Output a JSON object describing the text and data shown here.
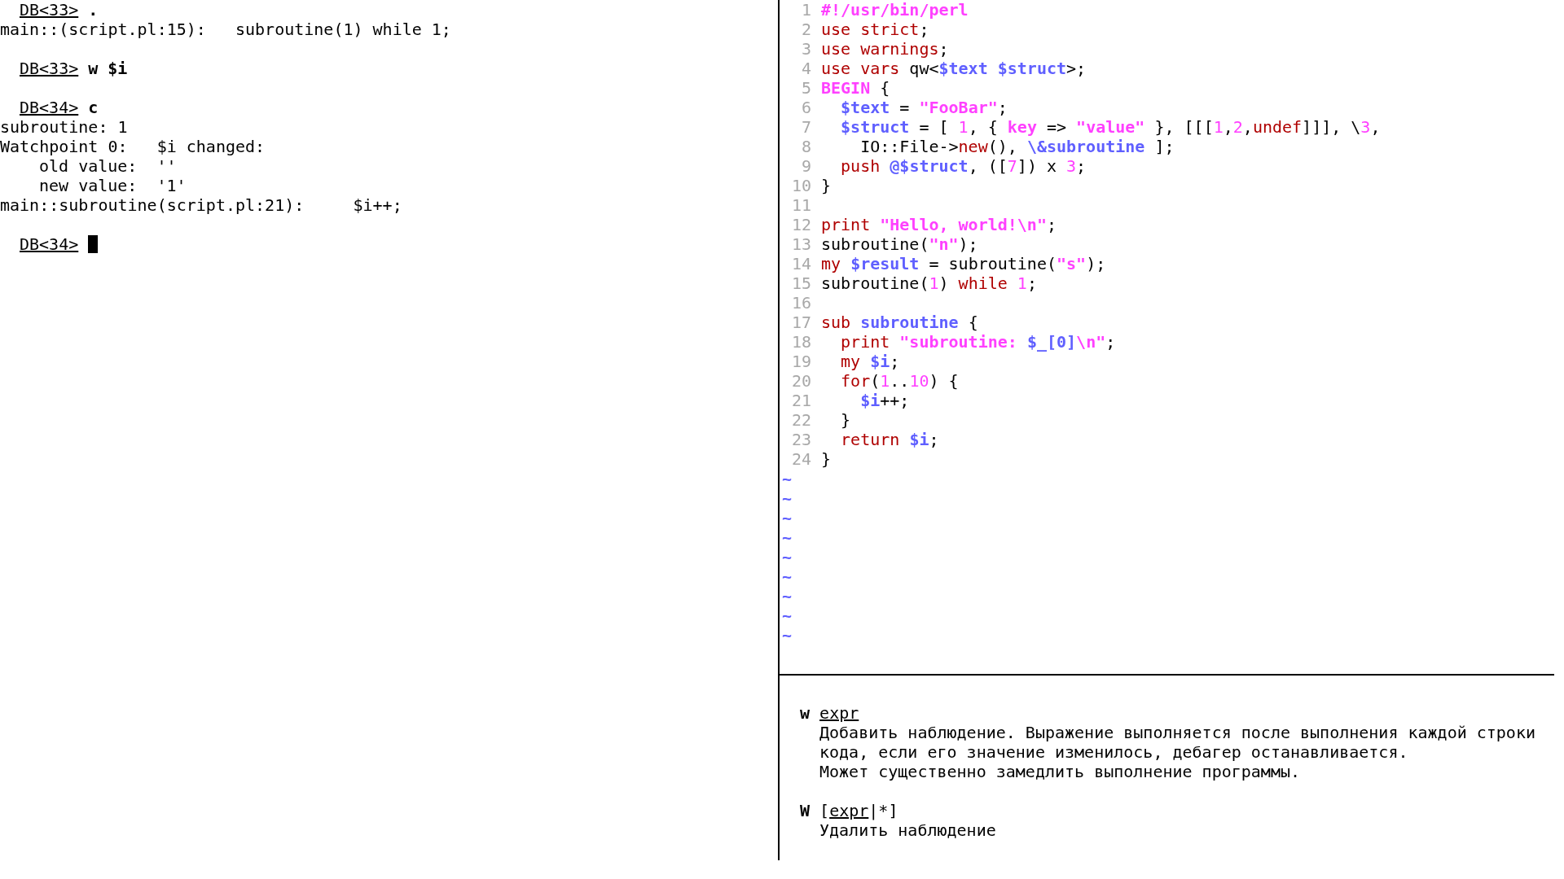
{
  "terminal": {
    "lines": [
      {
        "kind": "prompt",
        "prompt": "DB<33>",
        "command": ".",
        "cursor": false
      },
      {
        "kind": "output",
        "text": "main::(script.pl:15):   subroutine(1) while 1;"
      },
      {
        "kind": "blank"
      },
      {
        "kind": "prompt",
        "prompt": "DB<33>",
        "command": "w $i",
        "cursor": false
      },
      {
        "kind": "blank"
      },
      {
        "kind": "prompt",
        "prompt": "DB<34>",
        "command": "c",
        "cursor": false
      },
      {
        "kind": "output",
        "text": "subroutine: 1"
      },
      {
        "kind": "output",
        "text": "Watchpoint 0:   $i changed:"
      },
      {
        "kind": "detail",
        "text": "old value:  ''"
      },
      {
        "kind": "detail",
        "text": "new value:  '1'"
      },
      {
        "kind": "output",
        "text": "main::subroutine(script.pl:21):     $i++;"
      },
      {
        "kind": "blank"
      },
      {
        "kind": "prompt",
        "prompt": "DB<34>",
        "cursor": true
      }
    ]
  },
  "editor": {
    "lines": [
      {
        "number": "1",
        "tokens": [
          {
            "text": "#!/usr/bin/perl",
            "kind": "preproc"
          }
        ]
      },
      {
        "number": "2",
        "tokens": [
          {
            "text": "use strict",
            "kind": "keyword"
          },
          {
            "text": ";",
            "kind": "plain"
          }
        ]
      },
      {
        "number": "3",
        "tokens": [
          {
            "text": "use warnings",
            "kind": "keyword"
          },
          {
            "text": ";",
            "kind": "plain"
          }
        ]
      },
      {
        "number": "4",
        "tokens": [
          {
            "text": "use vars",
            "kind": "keyword"
          },
          {
            "text": " qw<",
            "kind": "plain"
          },
          {
            "text": "$text $struct",
            "kind": "variable"
          },
          {
            "text": ">;",
            "kind": "plain"
          }
        ]
      },
      {
        "number": "5",
        "tokens": [
          {
            "text": "BEGIN",
            "kind": "preproc"
          },
          {
            "text": " {",
            "kind": "plain"
          }
        ]
      },
      {
        "number": "6",
        "tokens": [
          {
            "text": "  $text",
            "kind": "variable"
          },
          {
            "text": " = ",
            "kind": "plain"
          },
          {
            "text": "\"FooBar\"",
            "kind": "string"
          },
          {
            "text": ";",
            "kind": "plain"
          }
        ]
      },
      {
        "number": "7",
        "tokens": [
          {
            "text": "  $struct",
            "kind": "variable"
          },
          {
            "text": " = [ ",
            "kind": "plain"
          },
          {
            "text": "1",
            "kind": "number"
          },
          {
            "text": ", { ",
            "kind": "plain"
          },
          {
            "text": "key",
            "kind": "string"
          },
          {
            "text": " => ",
            "kind": "plain"
          },
          {
            "text": "\"value\"",
            "kind": "string"
          },
          {
            "text": " }, [[[",
            "kind": "plain"
          },
          {
            "text": "1",
            "kind": "number"
          },
          {
            "text": ",",
            "kind": "plain"
          },
          {
            "text": "2",
            "kind": "number"
          },
          {
            "text": ",",
            "kind": "plain"
          },
          {
            "text": "undef",
            "kind": "keyword"
          },
          {
            "text": "]]], \\",
            "kind": "plain"
          },
          {
            "text": "3",
            "kind": "number"
          },
          {
            "text": ",",
            "kind": "plain"
          }
        ]
      },
      {
        "number": "8",
        "tokens": [
          {
            "text": "    IO::File->",
            "kind": "plain"
          },
          {
            "text": "new",
            "kind": "keyword"
          },
          {
            "text": "(), ",
            "kind": "plain"
          },
          {
            "text": "\\&subroutine",
            "kind": "variable"
          },
          {
            "text": " ];",
            "kind": "plain"
          }
        ]
      },
      {
        "number": "9",
        "tokens": [
          {
            "text": "  push ",
            "kind": "keyword"
          },
          {
            "text": "@$struct",
            "kind": "variable"
          },
          {
            "text": ", ([",
            "kind": "plain"
          },
          {
            "text": "7",
            "kind": "number"
          },
          {
            "text": "]) x ",
            "kind": "plain"
          },
          {
            "text": "3",
            "kind": "number"
          },
          {
            "text": ";",
            "kind": "plain"
          }
        ]
      },
      {
        "number": "10",
        "tokens": [
          {
            "text": "}",
            "kind": "plain"
          }
        ]
      },
      {
        "number": "11"
      },
      {
        "number": "12",
        "tokens": [
          {
            "text": "print ",
            "kind": "keyword"
          },
          {
            "text": "\"Hello, world!\\n\"",
            "kind": "string"
          },
          {
            "text": ";",
            "kind": "plain"
          }
        ]
      },
      {
        "number": "13",
        "tokens": [
          {
            "text": "subroutine(",
            "kind": "plain"
          },
          {
            "text": "\"n\"",
            "kind": "string"
          },
          {
            "text": ");",
            "kind": "plain"
          }
        ]
      },
      {
        "number": "14",
        "tokens": [
          {
            "text": "my ",
            "kind": "keyword"
          },
          {
            "text": "$result",
            "kind": "variable"
          },
          {
            "text": " = subroutine(",
            "kind": "plain"
          },
          {
            "text": "\"s\"",
            "kind": "string"
          },
          {
            "text": ");",
            "kind": "plain"
          }
        ]
      },
      {
        "number": "15",
        "tokens": [
          {
            "text": "subroutine(",
            "kind": "plain"
          },
          {
            "text": "1",
            "kind": "number"
          },
          {
            "text": ") ",
            "kind": "plain"
          },
          {
            "text": "while ",
            "kind": "keyword"
          },
          {
            "text": "1",
            "kind": "number"
          },
          {
            "text": ";",
            "kind": "plain"
          }
        ]
      },
      {
        "number": "16"
      },
      {
        "number": "17",
        "tokens": [
          {
            "text": "sub ",
            "kind": "keyword"
          },
          {
            "text": "subroutine",
            "kind": "variable"
          },
          {
            "text": " {",
            "kind": "plain"
          }
        ]
      },
      {
        "number": "18",
        "tokens": [
          {
            "text": "  print ",
            "kind": "keyword"
          },
          {
            "text": "\"subroutine: ",
            "kind": "string"
          },
          {
            "text": "$_[0]",
            "kind": "variable"
          },
          {
            "text": "\\n\"",
            "kind": "string"
          },
          {
            "text": ";",
            "kind": "plain"
          }
        ]
      },
      {
        "number": "19",
        "tokens": [
          {
            "text": "  my ",
            "kind": "keyword"
          },
          {
            "text": "$i",
            "kind": "variable"
          },
          {
            "text": ";",
            "kind": "plain"
          }
        ]
      },
      {
        "number": "20",
        "tokens": [
          {
            "text": "  for",
            "kind": "keyword"
          },
          {
            "text": "(",
            "kind": "plain"
          },
          {
            "text": "1",
            "kind": "number"
          },
          {
            "text": "..",
            "kind": "plain"
          },
          {
            "text": "10",
            "kind": "number"
          },
          {
            "text": ") {",
            "kind": "plain"
          }
        ]
      },
      {
        "number": "21",
        "tokens": [
          {
            "text": "    $i",
            "kind": "variable"
          },
          {
            "text": "++;",
            "kind": "plain"
          }
        ]
      },
      {
        "number": "22",
        "tokens": [
          {
            "text": "  }",
            "kind": "plain"
          }
        ]
      },
      {
        "number": "23",
        "tokens": [
          {
            "text": "  return ",
            "kind": "keyword"
          },
          {
            "text": "$i",
            "kind": "variable"
          },
          {
            "text": ";",
            "kind": "plain"
          }
        ]
      },
      {
        "number": "24",
        "tokens": [
          {
            "text": "}",
            "kind": "plain"
          }
        ]
      }
    ],
    "filler_lines": [
      "~",
      "~",
      "~",
      "~",
      "~",
      "~",
      "~",
      "~",
      "~"
    ]
  },
  "help": {
    "entries": [
      {
        "syntax": [
          {
            "text": "w ",
            "kind": "command"
          },
          {
            "text": "expr",
            "kind": "argument"
          }
        ],
        "description": [
          "Добавить наблюдение. Выражение выполняется после выполнения каждой строки",
          "кода, если его значение изменилось, дебагер останавливается.",
          "Может существенно замедлить выполнение программы."
        ]
      },
      {
        "syntax": [
          {
            "text": "W",
            "kind": "command"
          },
          {
            "text": " [",
            "kind": "plain"
          },
          {
            "text": "expr",
            "kind": "argument"
          },
          {
            "text": "|*]",
            "kind": "plain"
          }
        ],
        "description": [
          "Удалить наблюдение"
        ]
      }
    ]
  }
}
